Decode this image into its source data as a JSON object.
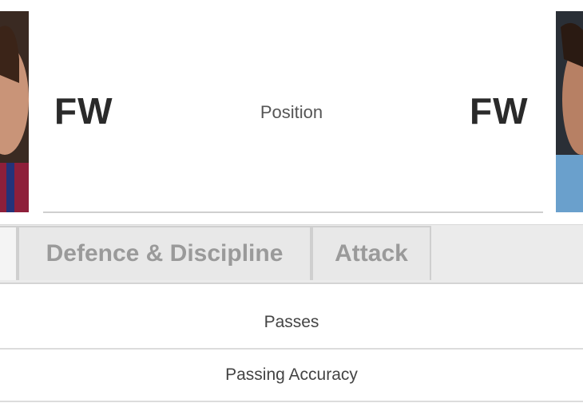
{
  "players": {
    "left": {
      "position": "FW",
      "photo_icon": "player-photo"
    },
    "right": {
      "position": "FW",
      "photo_icon": "player-photo"
    }
  },
  "position_label": "Position",
  "tabs": [
    {
      "label": ""
    },
    {
      "label": "Defence & Discipline"
    },
    {
      "label": "Attack"
    }
  ],
  "stats": [
    {
      "label": "Passes"
    },
    {
      "label": "Passing Accuracy"
    }
  ],
  "colors": {
    "tab_text": "#9a9a9a",
    "tab_bg": "#e8e8e8",
    "position_text": "#2a2a2a"
  }
}
